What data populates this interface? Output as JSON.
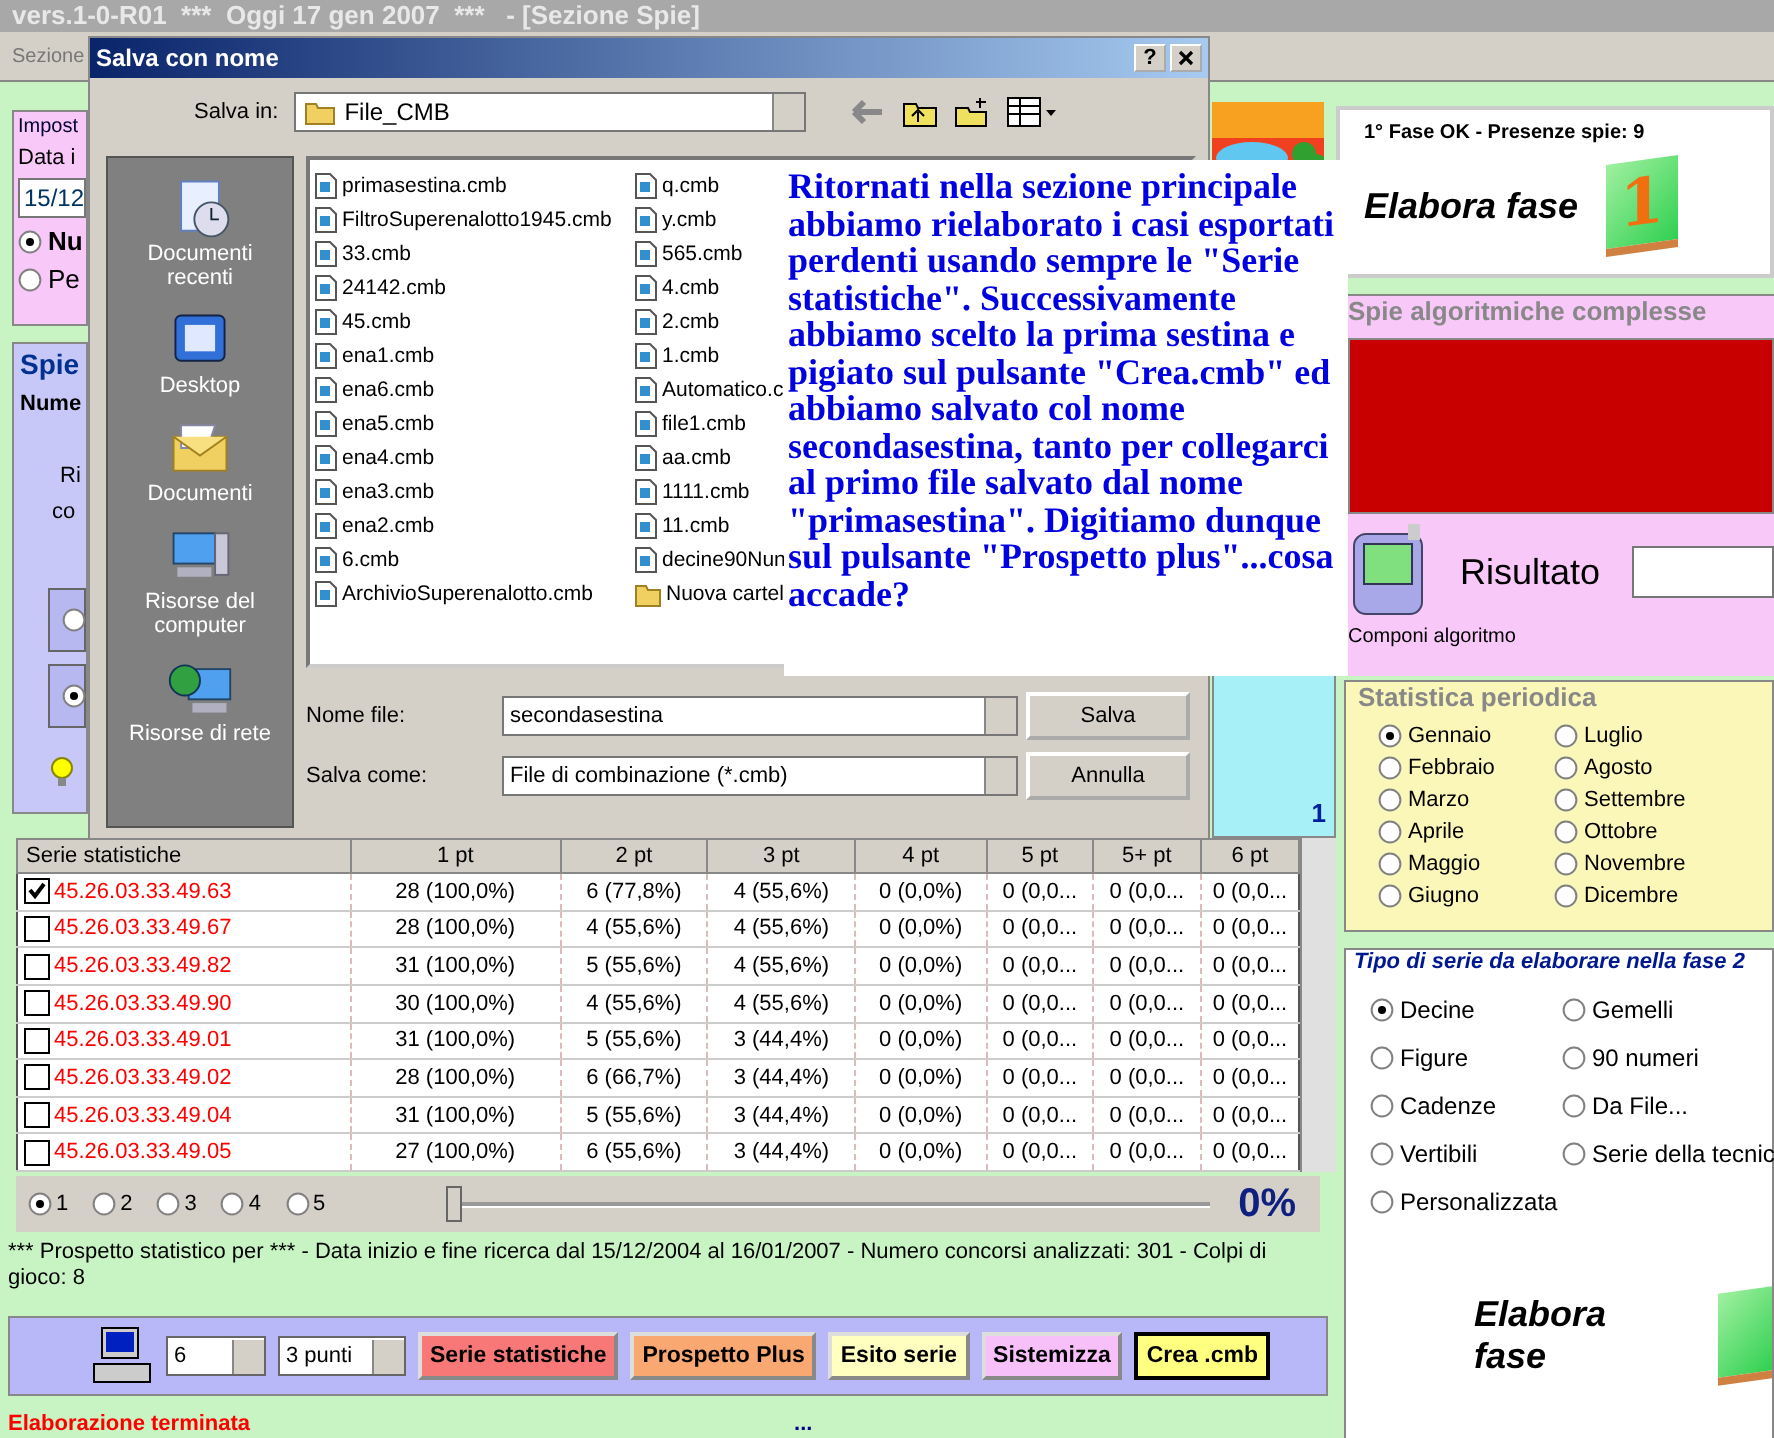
{
  "title_bar": {
    "text": "vers.1-0-R01  ***  Oggi 17 gen 2007  ***   - [Sezione Spie]"
  },
  "menu": [
    "Sezione"
  ],
  "left_panel": {
    "legend": "Impost",
    "date_label": "Data i",
    "date_value": "15/12",
    "options": [
      {
        "label": "Nu",
        "selected": true
      },
      {
        "label": "Pe",
        "selected": false
      }
    ],
    "spie_legend": "Spie",
    "count_label": "Nume",
    "text_1": "Ri",
    "text_2": "co",
    "inner_options": [
      {
        "selected": false
      },
      {
        "selected": true
      }
    ]
  },
  "dialog": {
    "title": "Salva con nome",
    "help": "?",
    "save_in_label": "Salva in:",
    "folder": "File_CMB",
    "places": [
      {
        "label": "Documenti recenti",
        "kind": "recent"
      },
      {
        "label": "Desktop",
        "kind": "desktop"
      },
      {
        "label": "Documenti",
        "kind": "documents"
      },
      {
        "label": "Risorse del computer",
        "kind": "computer"
      },
      {
        "label": "Risorse di rete",
        "kind": "network"
      }
    ],
    "files": [
      {
        "name": "primasestina.cmb",
        "kind": "file"
      },
      {
        "name": "FiltroSuperenalotto1945.cmb",
        "kind": "file"
      },
      {
        "name": "33.cmb",
        "kind": "file"
      },
      {
        "name": "24142.cmb",
        "kind": "file"
      },
      {
        "name": "45.cmb",
        "kind": "file"
      },
      {
        "name": "ena1.cmb",
        "kind": "file"
      },
      {
        "name": "ena6.cmb",
        "kind": "file"
      },
      {
        "name": "ena5.cmb",
        "kind": "file"
      },
      {
        "name": "ena4.cmb",
        "kind": "file"
      },
      {
        "name": "ena3.cmb",
        "kind": "file"
      },
      {
        "name": "ena2.cmb",
        "kind": "file"
      },
      {
        "name": "6.cmb",
        "kind": "file"
      },
      {
        "name": "ArchivioSuperenalotto.cmb",
        "kind": "file"
      },
      {
        "name": "q.cmb",
        "kind": "file"
      },
      {
        "name": "y.cmb",
        "kind": "file"
      },
      {
        "name": "565.cmb",
        "kind": "file"
      },
      {
        "name": "4.cmb",
        "kind": "file"
      },
      {
        "name": "2.cmb",
        "kind": "file"
      },
      {
        "name": "1.cmb",
        "kind": "file"
      },
      {
        "name": "Automatico.c",
        "kind": "file"
      },
      {
        "name": "file1.cmb",
        "kind": "file"
      },
      {
        "name": "aa.cmb",
        "kind": "file"
      },
      {
        "name": "1111.cmb",
        "kind": "file"
      },
      {
        "name": "11.cmb",
        "kind": "file"
      },
      {
        "name": "decine90Nun",
        "kind": "file"
      },
      {
        "name": "Nuova cartel",
        "kind": "folder"
      }
    ],
    "file_name_label": "Nome file:",
    "file_name": "secondasestina",
    "save_as_label": "Salva come:",
    "save_as": "File di combinazione (*.cmb)",
    "buttons": [
      "Salva",
      "Annulla"
    ]
  },
  "note": {
    "text": "Ritornati nella sezione principale abbiamo rielaborato i casi esportati perdenti usando sempre le \"Serie statistiche\". Successivamente abbiamo scelto la prima sestina e pigiato sul pulsante \"Crea.cmb\" ed abbiamo salvato col nome secondasestina, tanto per collegarci al primo file salvato dal nome \"primasestina\". Digitiamo dunque sul pulsante \"Prospetto plus\"...cosa accade?"
  },
  "side_marker": "1",
  "phase1": {
    "status": "1° Fase OK - Presenze spie: 9",
    "label": "Elabora fase",
    "number": "1"
  },
  "algo_panel": {
    "legend": "Spie algoritmiche complesse",
    "result_label": "Risultato",
    "compose_label": "Componi algoritmo"
  },
  "periodic": {
    "legend": "Statistica periodica",
    "months": [
      {
        "label": "Gennaio",
        "selected": true
      },
      {
        "label": "Febbraio",
        "selected": false
      },
      {
        "label": "Marzo",
        "selected": false
      },
      {
        "label": "Aprile",
        "selected": false
      },
      {
        "label": "Maggio",
        "selected": false
      },
      {
        "label": "Giugno",
        "selected": false
      },
      {
        "label": "Luglio",
        "selected": false
      },
      {
        "label": "Agosto",
        "selected": false
      },
      {
        "label": "Settembre",
        "selected": false
      },
      {
        "label": "Ottobre",
        "selected": false
      },
      {
        "label": "Novembre",
        "selected": false
      },
      {
        "label": "Dicembre",
        "selected": false
      }
    ]
  },
  "series_type": {
    "legend": "Tipo di serie da elaborare nella fase 2",
    "options": [
      {
        "label": "Decine",
        "selected": true
      },
      {
        "label": "Gemelli",
        "selected": false
      },
      {
        "label": "Figure",
        "selected": false
      },
      {
        "label": "90 numeri",
        "selected": false
      },
      {
        "label": "Cadenze",
        "selected": false
      },
      {
        "label": "Da File...",
        "selected": false
      },
      {
        "label": "Vertibili",
        "selected": false
      },
      {
        "label": "Serie della tecnic",
        "selected": false
      },
      {
        "label": "Personalizzata",
        "selected": false
      }
    ],
    "label": "Elabora fase"
  },
  "table": {
    "columns": [
      "Serie statistiche",
      "1 pt",
      "2 pt",
      "3 pt",
      "4 pt",
      "5 pt",
      "5+ pt",
      "6 pt"
    ],
    "rows": [
      {
        "checked": true,
        "cells": [
          "45.26.03.33.49.63",
          "28 (100,0%)",
          "6 (77,8%)",
          "4 (55,6%)",
          "0 (0,0%)",
          "0 (0,0...",
          "0 (0,0...",
          "0 (0,0..."
        ]
      },
      {
        "checked": false,
        "cells": [
          "45.26.03.33.49.67",
          "28 (100,0%)",
          "4 (55,6%)",
          "4 (55,6%)",
          "0 (0,0%)",
          "0 (0,0...",
          "0 (0,0...",
          "0 (0,0..."
        ]
      },
      {
        "checked": false,
        "cells": [
          "45.26.03.33.49.82",
          "31 (100,0%)",
          "5 (55,6%)",
          "4 (55,6%)",
          "0 (0,0%)",
          "0 (0,0...",
          "0 (0,0...",
          "0 (0,0..."
        ]
      },
      {
        "checked": false,
        "cells": [
          "45.26.03.33.49.90",
          "30 (100,0%)",
          "4 (55,6%)",
          "4 (55,6%)",
          "0 (0,0%)",
          "0 (0,0...",
          "0 (0,0...",
          "0 (0,0..."
        ]
      },
      {
        "checked": false,
        "cells": [
          "45.26.03.33.49.01",
          "31 (100,0%)",
          "5 (55,6%)",
          "3 (44,4%)",
          "0 (0,0%)",
          "0 (0,0...",
          "0 (0,0...",
          "0 (0,0..."
        ]
      },
      {
        "checked": false,
        "cells": [
          "45.26.03.33.49.02",
          "28 (100,0%)",
          "6 (66,7%)",
          "3 (44,4%)",
          "0 (0,0%)",
          "0 (0,0...",
          "0 (0,0...",
          "0 (0,0..."
        ]
      },
      {
        "checked": false,
        "cells": [
          "45.26.03.33.49.04",
          "31 (100,0%)",
          "5 (55,6%)",
          "3 (44,4%)",
          "0 (0,0%)",
          "0 (0,0...",
          "0 (0,0...",
          "0 (0,0..."
        ]
      },
      {
        "checked": false,
        "cells": [
          "45.26.03.33.49.05",
          "27 (100,0%)",
          "6 (55,6%)",
          "3 (44,4%)",
          "0 (0,0%)",
          "0 (0,0...",
          "0 (0,0...",
          "0 (0,0..."
        ]
      }
    ]
  },
  "pages": [
    {
      "label": "1",
      "selected": true
    },
    {
      "label": "2",
      "selected": false
    },
    {
      "label": "3",
      "selected": false
    },
    {
      "label": "4",
      "selected": false
    },
    {
      "label": "5",
      "selected": false
    }
  ],
  "progress": {
    "level": 0,
    "reading": "0%"
  },
  "info": "*** Prospetto statistico per  ***  - Data inizio e fine ricerca dal 15/12/2004 al 16/01/2007 - Numero concorsi analizzati: 301 - Colpi di gioco: 8",
  "toolbar": {
    "count": "6",
    "points": "3 punti",
    "buttons": [
      {
        "label": "Serie statistiche",
        "color": "#f87878"
      },
      {
        "label": "Prospetto Plus",
        "color": "#f8a870"
      },
      {
        "label": "Esito serie",
        "color": "#ffffc0"
      },
      {
        "label": "Sistemizza",
        "color": "#f8c0f8"
      },
      {
        "label": "Crea .cmb",
        "color": "#ffff80"
      }
    ]
  },
  "status": {
    "message": "Elaborazione terminata",
    "extra": "..."
  }
}
